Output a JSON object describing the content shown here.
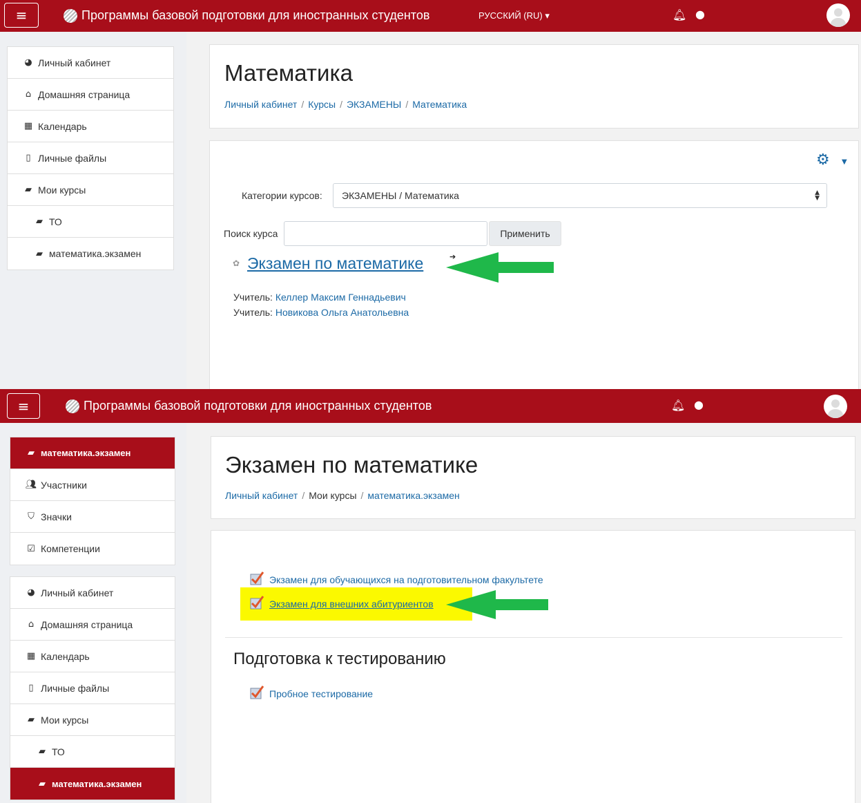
{
  "colors": {
    "brand_red": "#a80e1a",
    "link": "#1c6aa6",
    "highlight": "#fbf900",
    "arrow": "#1fb84a"
  },
  "top": {
    "navbar": {
      "site_title": "Программы базовой подготовки для иностранных студентов",
      "language": "РУССКИЙ (RU) ▾"
    },
    "nav": [
      {
        "icon": "dashboard-icon",
        "label": "Личный кабинет"
      },
      {
        "icon": "home-icon",
        "label": "Домашняя страница"
      },
      {
        "icon": "calendar-icon",
        "label": "Календарь"
      },
      {
        "icon": "file-icon",
        "label": "Личные файлы"
      },
      {
        "icon": "graduation-cap-icon",
        "label": "Мои курсы"
      },
      {
        "icon": "graduation-cap-icon",
        "label": "ТО"
      },
      {
        "icon": "graduation-cap-icon",
        "label": "математика.экзамен"
      }
    ],
    "header": {
      "title": "Математика",
      "breadcrumb": [
        "Личный кабинет",
        "Курсы",
        "ЭКЗАМЕНЫ",
        "Математика"
      ]
    },
    "course_list": {
      "category_label": "Категории курсов:",
      "category_value": "ЭКЗАМЕНЫ / Математика",
      "search_label": "Поиск курса",
      "search_value": "",
      "apply_button": "Применить",
      "course_name": "Экзамен по математике",
      "teachers": [
        {
          "label": "Учитель:",
          "name": "Келлер Максим Геннадьевич"
        },
        {
          "label": "Учитель:",
          "name": "Новикова Ольга Анатольевна"
        }
      ]
    }
  },
  "bottom": {
    "navbar": {
      "site_title": "Программы базовой подготовки для иностранных студентов"
    },
    "course_nav": [
      {
        "icon": "graduation-cap-icon",
        "label": "математика.экзамен",
        "active": true
      },
      {
        "icon": "users-icon",
        "label": "Участники"
      },
      {
        "icon": "shield-icon",
        "label": "Значки"
      },
      {
        "icon": "checkbox-icon",
        "label": "Компетенции"
      }
    ],
    "nav": [
      {
        "icon": "dashboard-icon",
        "label": "Личный кабинет"
      },
      {
        "icon": "home-icon",
        "label": "Домашняя страница"
      },
      {
        "icon": "calendar-icon",
        "label": "Календарь"
      },
      {
        "icon": "file-icon",
        "label": "Личные файлы"
      },
      {
        "icon": "graduation-cap-icon",
        "label": "Мои курсы"
      },
      {
        "icon": "graduation-cap-icon",
        "label": "ТО"
      },
      {
        "icon": "graduation-cap-icon",
        "label": "математика.экзамен",
        "active": true
      }
    ],
    "header": {
      "title": "Экзамен по математике",
      "breadcrumb": [
        "Личный кабинет",
        "Мои курсы",
        "математика.экзамен"
      ]
    },
    "activities": [
      {
        "icon": "quiz-icon",
        "label": "Экзамен для обучающихся на подготовительном факультете"
      },
      {
        "icon": "quiz-icon",
        "label": "Экзамен для внешних абитуриентов",
        "highlighted": true
      }
    ],
    "section": {
      "title": "Подготовка к тестированию",
      "activities": [
        {
          "icon": "quiz-icon",
          "label": "Пробное тестирование"
        }
      ]
    }
  }
}
